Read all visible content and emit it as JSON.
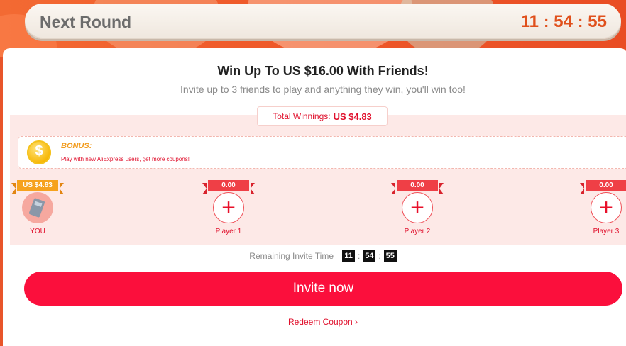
{
  "round": {
    "title": "Next Round",
    "hours": "11",
    "minutes": "54",
    "seconds": "55",
    "separator": ":"
  },
  "panel": {
    "heading": "Win Up To US $16.00 With Friends!",
    "subheading": "Invite up to 3 friends to play and anything they win, you'll win too!",
    "winnings_label": "Total Winnings:",
    "winnings_value": "US $4.83"
  },
  "bonus": {
    "icon": "coin-icon",
    "title": "BONUS:",
    "text": "Play with new AliExpress users, get more coupons!"
  },
  "players": [
    {
      "amount": "US $4.83",
      "label": "YOU"
    },
    {
      "amount": "0.00",
      "label": "Player 1"
    },
    {
      "amount": "0.00",
      "label": "Player 2"
    },
    {
      "amount": "0.00",
      "label": "Player 3"
    }
  ],
  "invite_time": {
    "label": "Remaining Invite Time",
    "hours": "11",
    "minutes": "54",
    "seconds": "55",
    "separator": ":"
  },
  "invite_button": "Invite now",
  "redeem_link": "Redeem Coupon",
  "redeem_chevron": "›",
  "add_symbol": "+",
  "colors": {
    "accent": "#fb0f3c",
    "timer": "#e0501c",
    "gold": "#f6a21e"
  }
}
